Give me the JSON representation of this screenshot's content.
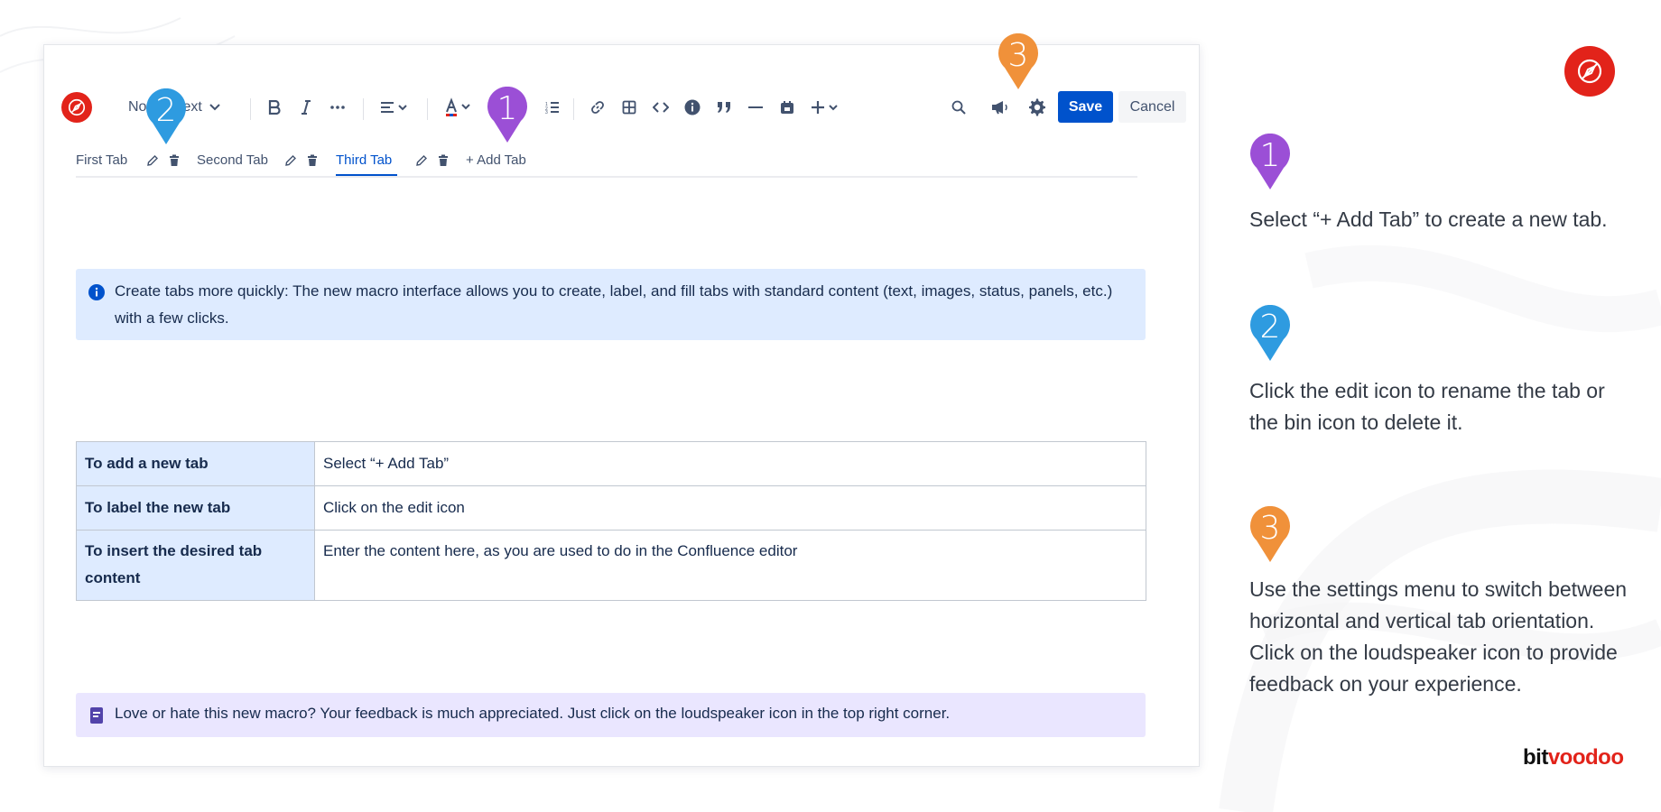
{
  "colors": {
    "brand_red": "#e2231a",
    "primary_blue": "#0052cc",
    "info_bg": "#deebff",
    "note_bg": "#eae6ff",
    "pin1": "#9b4fd6",
    "pin2": "#2e9be0",
    "pin3": "#f0913a"
  },
  "toolbar": {
    "text_style": "Normal text",
    "save_label": "Save",
    "cancel_label": "Cancel",
    "icons": [
      "bold-icon",
      "italic-icon",
      "more-formatting-icon",
      "align-icon",
      "text-color-icon",
      "bullet-list-icon",
      "numbered-list-icon",
      "link-icon",
      "table-icon",
      "code-icon",
      "info-icon",
      "quote-icon",
      "divider-icon",
      "date-icon",
      "insert-plus-icon",
      "search-icon",
      "loudspeaker-icon",
      "gear-icon"
    ]
  },
  "tabs": {
    "items": [
      {
        "label": "First Tab",
        "active": false
      },
      {
        "label": "Second Tab",
        "active": false
      },
      {
        "label": "Third Tab",
        "active": true
      }
    ],
    "add_label": "+  Add Tab"
  },
  "info_panel": {
    "text": "Create tabs more quickly: The new macro interface allows you to create, label, and fill tabs with standard content (text, images, status, panels, etc.) with a few clicks."
  },
  "table": {
    "rows": [
      {
        "key": "To add a new tab",
        "value": "Select “+ Add Tab”"
      },
      {
        "key": "To label the new tab",
        "value": "Click on the edit icon"
      },
      {
        "key": "To insert the desired tab content",
        "value": "Enter the content here, as you are used to do in the Confluence editor"
      }
    ]
  },
  "note_panel": {
    "text": "Love or hate this new macro? Your feedback is much appreciated. Just click on the loudspeaker icon in the top right corner."
  },
  "pins": {
    "one": "1",
    "two": "2",
    "three": "3"
  },
  "steps": [
    {
      "number": "1",
      "text": "Select “+ Add Tab” to create a new tab."
    },
    {
      "number": "2",
      "text": "Click the edit icon to rename the tab or the bin icon to delete it."
    },
    {
      "number": "3",
      "text": "Use the settings menu to switch between horizontal and vertical tab orientation. Click on the loudspeaker icon to provide feedback on your experience."
    }
  ],
  "brand": {
    "part1": "bit",
    "part2": "voodoo"
  }
}
